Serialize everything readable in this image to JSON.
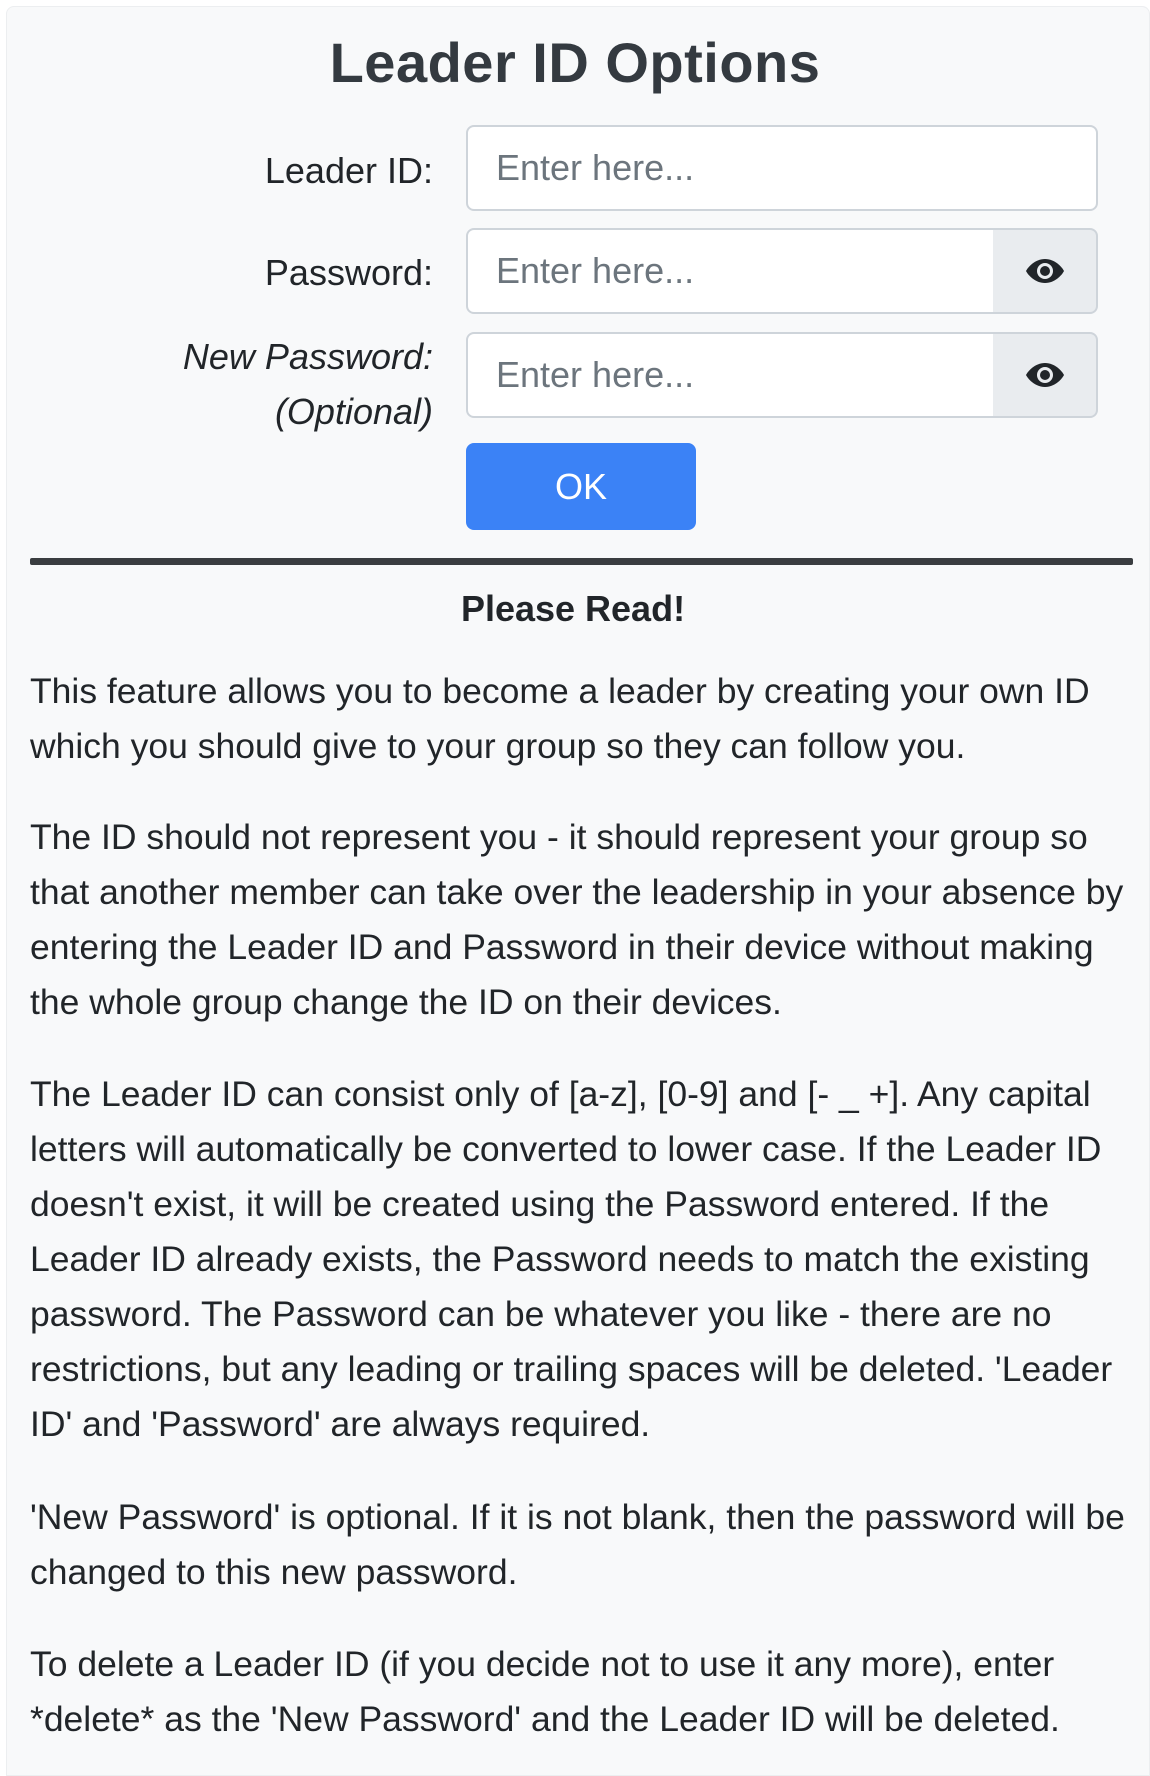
{
  "dialog": {
    "title": "Leader ID Options"
  },
  "form": {
    "leader_id_label": "Leader ID:",
    "leader_id_placeholder": "Enter here...",
    "password_label": "Password:",
    "password_placeholder": "Enter here...",
    "new_password_label_line1": "New Password:",
    "new_password_label_line2": "(Optional)",
    "new_password_placeholder": "Enter here...",
    "ok_label": "OK"
  },
  "info": {
    "heading": "Please Read!",
    "paragraphs": [
      "This feature allows you to become a leader by creating your own ID which you should give to your group so they can follow you.",
      "The ID should not represent you - it should represent your group so that another member can take over the leadership in your absence by entering the Leader ID and Password in their device without making the whole group change the ID on their devices.",
      "The Leader ID can consist only of [a-z], [0-9] and [- _ +]. Any capital letters will automatically be converted to lower case. If the Leader ID doesn't exist, it will be created using the Password entered. If the Leader ID already exists, the Password needs to match the existing password. The Password can be whatever you like - there are no restrictions, but any leading or trailing spaces will be deleted. 'Leader ID' and 'Password' are always required.",
      "'New Password' is optional. If it is not blank, then the password will be changed to this new password.",
      "To delete a Leader ID (if you decide not to use it any more), enter *delete* as the 'New Password' and the Leader ID will be deleted."
    ]
  },
  "icons": {
    "password_toggle": "eye-icon",
    "new_password_toggle": "eye-icon"
  },
  "colors": {
    "primary_button": "#3b82f6",
    "panel_background": "#f8f9fa",
    "divider": "#3a3d40"
  }
}
